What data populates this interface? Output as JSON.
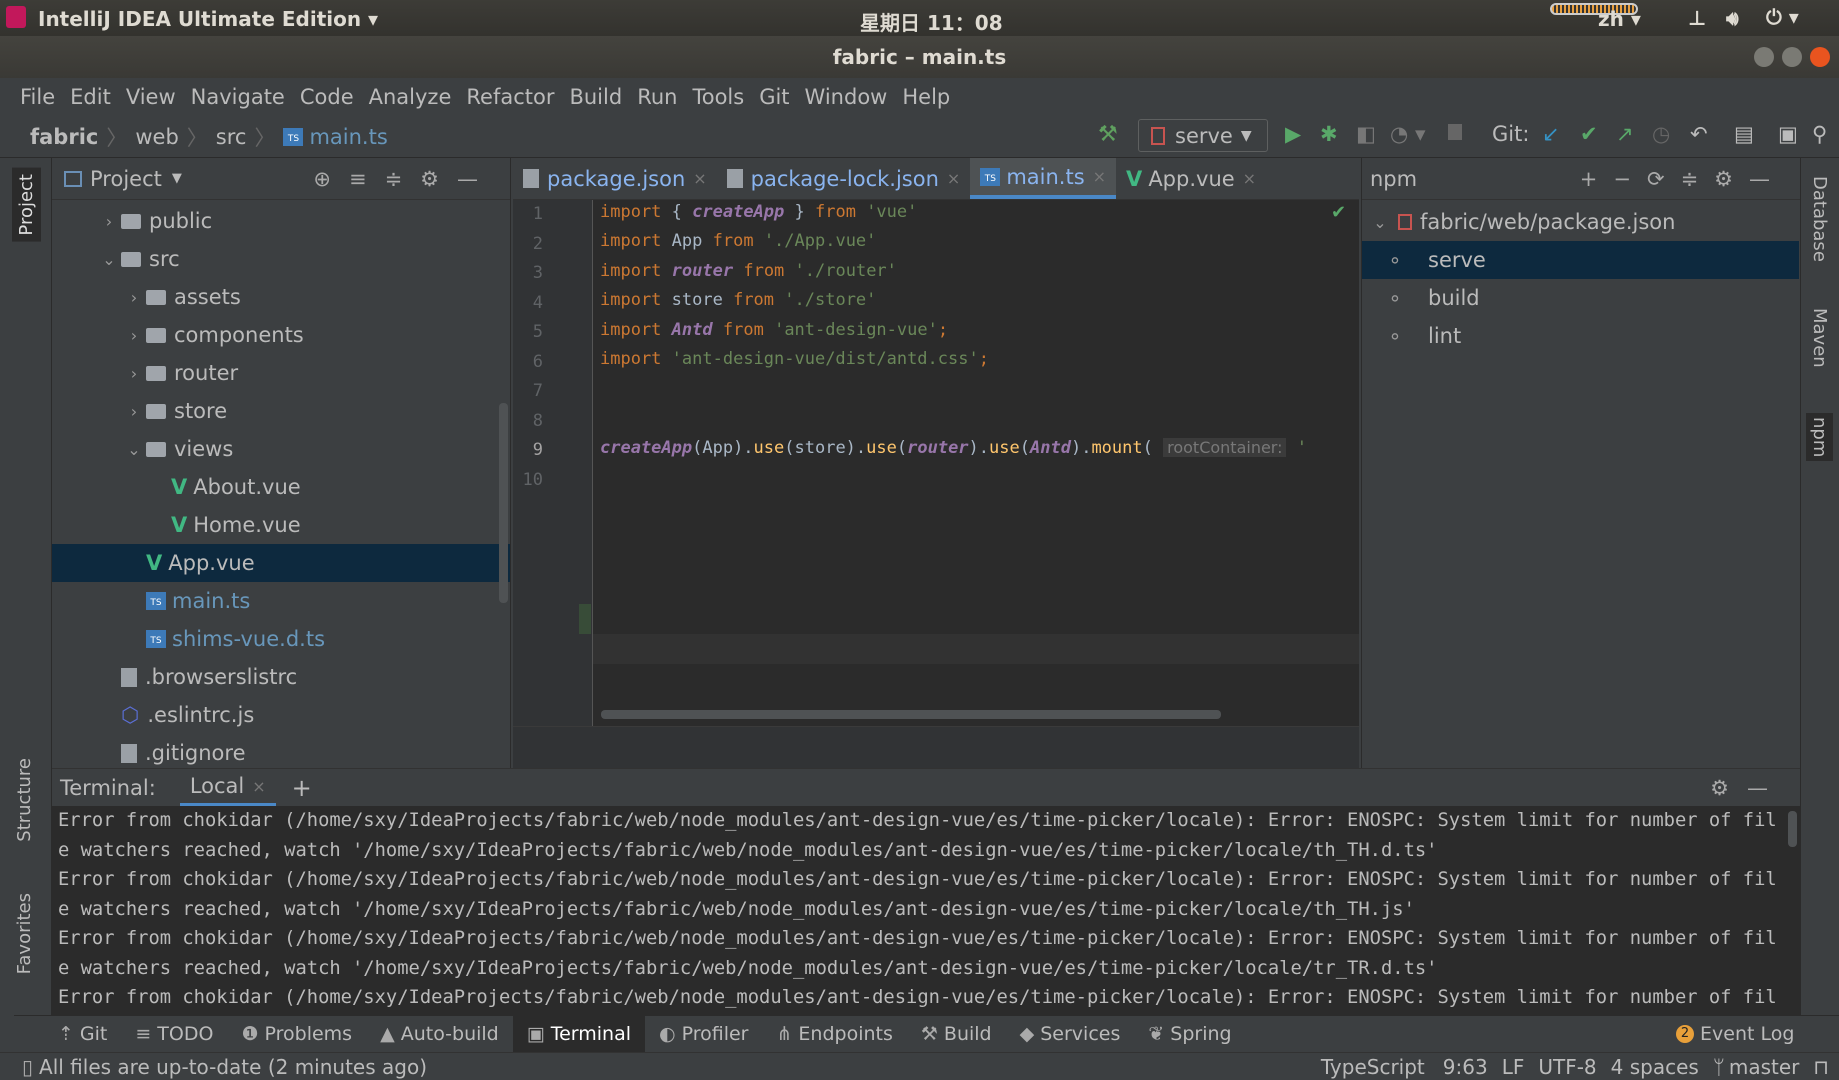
{
  "system": {
    "app_name": "IntelliJ IDEA Ultimate Edition",
    "clock": "星期日 11：08",
    "lang": "zh"
  },
  "window": {
    "title": "fabric – main.ts"
  },
  "menu": [
    "File",
    "Edit",
    "View",
    "Navigate",
    "Code",
    "Analyze",
    "Refactor",
    "Build",
    "Run",
    "Tools",
    "Git",
    "Window",
    "Help"
  ],
  "breadcrumb": [
    "fabric",
    "web",
    "src",
    "main.ts"
  ],
  "toolbar": {
    "run_config": "serve",
    "git_label": "Git:"
  },
  "project": {
    "title": "Project",
    "items": [
      {
        "label": "public",
        "type": "folder",
        "depth": 1,
        "expanded": false
      },
      {
        "label": "src",
        "type": "folder",
        "depth": 1,
        "expanded": true
      },
      {
        "label": "assets",
        "type": "folder",
        "depth": 2,
        "expanded": false
      },
      {
        "label": "components",
        "type": "folder",
        "depth": 2,
        "expanded": false
      },
      {
        "label": "router",
        "type": "folder",
        "depth": 2,
        "expanded": false
      },
      {
        "label": "store",
        "type": "folder",
        "depth": 2,
        "expanded": false
      },
      {
        "label": "views",
        "type": "folder",
        "depth": 2,
        "expanded": true
      },
      {
        "label": "About.vue",
        "type": "vue",
        "depth": 3
      },
      {
        "label": "Home.vue",
        "type": "vue",
        "depth": 3
      },
      {
        "label": "App.vue",
        "type": "vue",
        "depth": 2,
        "selected": true
      },
      {
        "label": "main.ts",
        "type": "ts",
        "depth": 2
      },
      {
        "label": "shims-vue.d.ts",
        "type": "ts",
        "depth": 2
      },
      {
        "label": ".browserslistrc",
        "type": "file",
        "depth": 1
      },
      {
        "label": ".eslintrc.js",
        "type": "eslint",
        "depth": 1
      },
      {
        "label": ".gitignore",
        "type": "file",
        "depth": 1
      }
    ]
  },
  "editor": {
    "tabs": [
      {
        "label": "package.json",
        "active": false
      },
      {
        "label": "package-lock.json",
        "active": false
      },
      {
        "label": "main.ts",
        "active": true
      },
      {
        "label": "App.vue",
        "active": false
      }
    ],
    "line_numbers": [
      "1",
      "2",
      "3",
      "4",
      "5",
      "6",
      "7",
      "8",
      "9",
      "10"
    ],
    "hint": "rootContainer:"
  },
  "npm": {
    "title": "npm",
    "root": "fabric/web/package.json",
    "scripts": [
      "serve",
      "build",
      "lint"
    ],
    "selected": "serve"
  },
  "left_stripe": [
    "Project",
    "Structure",
    "Favorites"
  ],
  "right_stripe": [
    "Database",
    "Maven",
    "npm"
  ],
  "terminal": {
    "label": "Terminal:",
    "tab": "Local",
    "lines": [
      "Error from chokidar (/home/sxy/IdeaProjects/fabric/web/node_modules/ant-design-vue/es/time-picker/locale): Error: ENOSPC: System limit for number of fil",
      "e watchers reached, watch '/home/sxy/IdeaProjects/fabric/web/node_modules/ant-design-vue/es/time-picker/locale/th_TH.d.ts'",
      "Error from chokidar (/home/sxy/IdeaProjects/fabric/web/node_modules/ant-design-vue/es/time-picker/locale): Error: ENOSPC: System limit for number of fil",
      "e watchers reached, watch '/home/sxy/IdeaProjects/fabric/web/node_modules/ant-design-vue/es/time-picker/locale/th_TH.js'",
      "Error from chokidar (/home/sxy/IdeaProjects/fabric/web/node_modules/ant-design-vue/es/time-picker/locale): Error: ENOSPC: System limit for number of fil",
      "e watchers reached, watch '/home/sxy/IdeaProjects/fabric/web/node_modules/ant-design-vue/es/time-picker/locale/tr_TR.d.ts'",
      "Error from chokidar (/home/sxy/IdeaProjects/fabric/web/node_modules/ant-design-vue/es/time-picker/locale): Error: ENOSPC: System limit for number of fil"
    ]
  },
  "toolwindows": [
    "Git",
    "TODO",
    "Problems",
    "Auto-build",
    "Terminal",
    "Profiler",
    "Endpoints",
    "Build",
    "Services",
    "Spring"
  ],
  "event_log": {
    "label": "Event Log",
    "count": "2"
  },
  "status": {
    "message": "All files are up-to-date (2 minutes ago)",
    "language": "TypeScript",
    "position": "9:63",
    "line_sep": "LF",
    "encoding": "UTF-8",
    "indent": "4 spaces",
    "branch": "master"
  }
}
